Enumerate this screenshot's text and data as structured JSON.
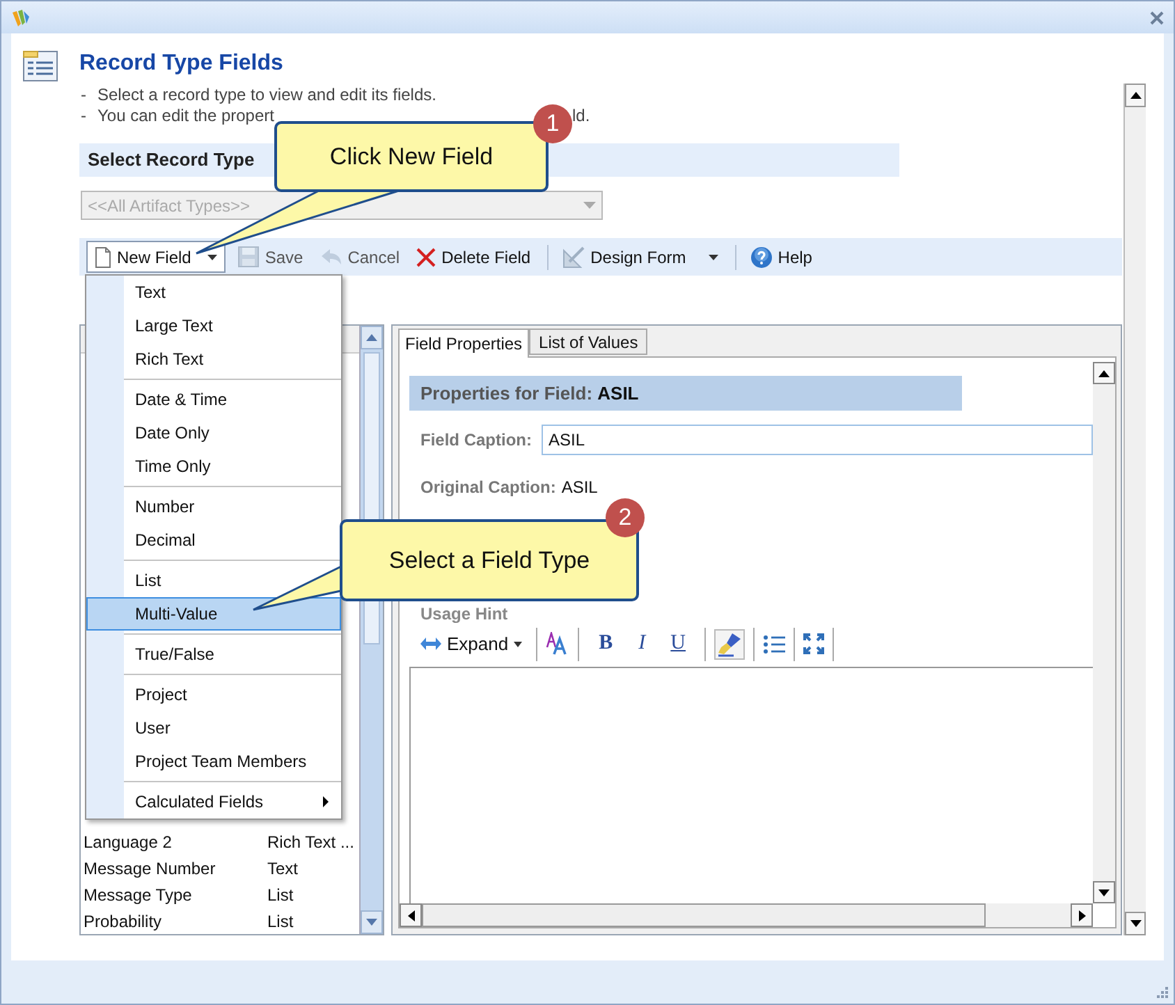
{
  "page": {
    "title": "Record Type Fields",
    "notes": [
      {
        "marker": "-",
        "parts": [
          "Select a record type to view and edit its fields."
        ]
      },
      {
        "marker": "-",
        "parts": [
          "You can edit the propert",
          "ld."
        ]
      }
    ]
  },
  "record_type": {
    "label": "Select Record Type",
    "dropdown": {
      "value": "<<All Artifact Types>>",
      "disabled": true
    }
  },
  "toolbar": [
    {
      "kind": "split",
      "label": "New Field",
      "disabled": false
    },
    {
      "kind": "button",
      "label": "Save",
      "disabled": true
    },
    {
      "kind": "button",
      "label": "Cancel",
      "disabled": true
    },
    {
      "kind": "button",
      "label": "Delete Field",
      "disabled": false
    },
    {
      "kind": "separator"
    },
    {
      "kind": "dropdown",
      "label": "Design Form",
      "disabled": false
    },
    {
      "kind": "separator"
    },
    {
      "kind": "button",
      "label": "Help",
      "disabled": false
    }
  ],
  "menu": {
    "groups": [
      [
        {
          "kind": "item",
          "label": "Text",
          "selected": false
        },
        {
          "kind": "item",
          "label": "Large Text",
          "selected": false
        },
        {
          "kind": "item",
          "label": "Rich Text",
          "selected": false
        }
      ],
      [
        {
          "kind": "item",
          "label": "Date & Time",
          "selected": false
        },
        {
          "kind": "item",
          "label": "Date Only",
          "selected": false
        },
        {
          "kind": "item",
          "label": "Time Only",
          "selected": false
        }
      ],
      [
        {
          "kind": "item",
          "label": "Number",
          "selected": false
        },
        {
          "kind": "item",
          "label": "Decimal",
          "selected": false
        }
      ],
      [
        {
          "kind": "item",
          "label": "List",
          "selected": false
        },
        {
          "kind": "item",
          "label": "Multi-Value",
          "selected": true
        }
      ],
      [
        {
          "kind": "item",
          "label": "True/False",
          "selected": false
        }
      ],
      [
        {
          "kind": "item",
          "label": "Project",
          "selected": false
        },
        {
          "kind": "item",
          "label": "User",
          "selected": false
        },
        {
          "kind": "item",
          "label": "Project Team Members",
          "selected": false
        }
      ],
      [
        {
          "kind": "submenu",
          "label": "Calculated Fields",
          "selected": false
        }
      ]
    ]
  },
  "field_list": {
    "rows": [
      {
        "name": "Language 2",
        "type": "Rich Text ..."
      },
      {
        "name": "Message Number",
        "type": "Text"
      },
      {
        "name": "Message Type",
        "type": "List"
      },
      {
        "name": "Probability",
        "type": "List"
      }
    ]
  },
  "properties": {
    "tabs": [
      {
        "label": "Field Properties",
        "selected": true
      },
      {
        "label": "List of Values",
        "selected": false
      }
    ],
    "header": "Properties for Field: **ASIL**",
    "field_caption": {
      "label": "Field Caption:",
      "value": "ASIL"
    },
    "original_caption": {
      "label": "Original Caption:",
      "value": "ASIL"
    },
    "usage_hint": {
      "label": "Usage Hint",
      "expand": "Expand",
      "format_buttons": [
        "B",
        "I",
        "U"
      ]
    }
  },
  "callouts": [
    {
      "number": "1",
      "text": "Click New Field"
    },
    {
      "number": "2",
      "text": "Select a Field Type"
    }
  ]
}
